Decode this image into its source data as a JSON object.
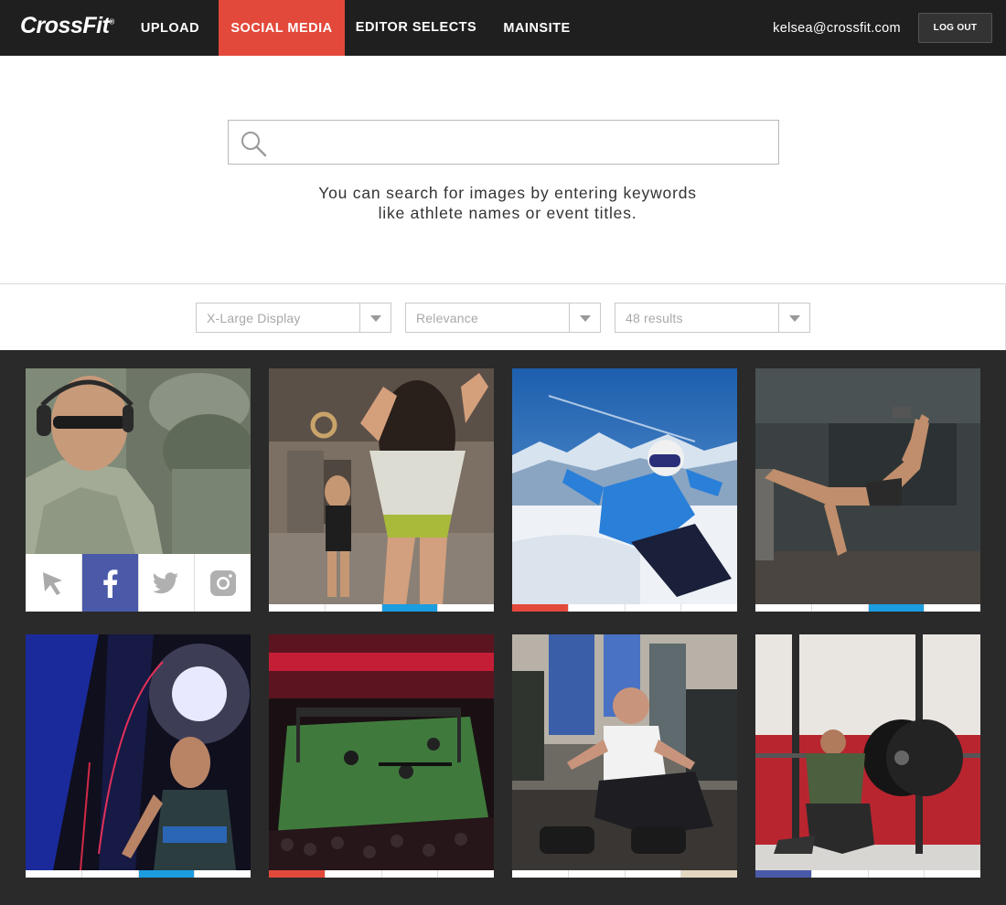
{
  "header": {
    "logo": "CrossFit",
    "logo_mark": "®",
    "nav": [
      {
        "label": "UPLOAD",
        "active": false
      },
      {
        "label": "SOCIAL MEDIA",
        "active": true
      },
      {
        "label": "EDITOR SELECTS",
        "active": false
      },
      {
        "label": "MAINSITE",
        "active": false
      }
    ],
    "user_email": "kelsea@crossfit.com",
    "logout_label": "LOG OUT"
  },
  "search": {
    "placeholder": "",
    "value": "",
    "hint_line1": "You can search for images by entering keywords",
    "hint_line2": "like athlete names or event titles."
  },
  "filters": {
    "display": "X-Large Display",
    "sort": "Relevance",
    "results": "48 results"
  },
  "colors": {
    "accent": "#e3493b",
    "facebook": "#4a5aa8",
    "twitter": "#1b9de0"
  },
  "photos": [
    {
      "subject": "soldier with headphones",
      "share_icons": [
        "cursor-icon",
        "facebook-icon",
        "twitter-icon",
        "instagram-icon"
      ],
      "strip": []
    },
    {
      "subject": "athlete on gymnastic rings",
      "strip": [
        "",
        "",
        "blue",
        ""
      ]
    },
    {
      "subject": "skier in snow",
      "strip": [
        "red",
        "",
        "",
        ""
      ]
    },
    {
      "subject": "athlete one-arm handstand",
      "strip": [
        "",
        "",
        "blue",
        ""
      ]
    },
    {
      "subject": "athlete jumping rope on stage",
      "strip": [
        "",
        "",
        "blue",
        ""
      ]
    },
    {
      "subject": "arena competition overhead view",
      "strip": [
        "red",
        "",
        "",
        ""
      ]
    },
    {
      "subject": "woman doing sit-up",
      "strip": [
        "",
        "",
        "",
        "tan"
      ]
    },
    {
      "subject": "athlete back squat",
      "strip": [
        "navy",
        "",
        "",
        ""
      ]
    }
  ]
}
